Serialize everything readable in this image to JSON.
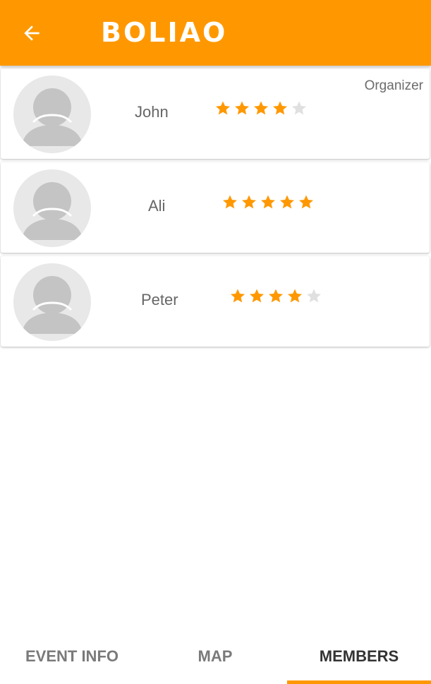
{
  "header": {
    "title": "BOLIAO",
    "back_icon": "arrow-left-icon",
    "background_color": "#ff9800"
  },
  "members": [
    {
      "name": "John",
      "rating": 4,
      "max_rating": 5,
      "role": "Organizer"
    },
    {
      "name": "Ali",
      "rating": 5,
      "max_rating": 5,
      "role": ""
    },
    {
      "name": "Peter",
      "rating": 4,
      "max_rating": 5,
      "role": ""
    }
  ],
  "tabs": [
    {
      "label": "EVENT INFO",
      "active": false
    },
    {
      "label": "MAP",
      "active": false
    },
    {
      "label": "MEMBERS",
      "active": true
    }
  ],
  "colors": {
    "accent": "#ff9800",
    "star_filled": "#ff9800",
    "star_empty": "#e0e0e0",
    "avatar_bg": "#e8e8e8",
    "avatar_fg": "#c4c4c4"
  }
}
